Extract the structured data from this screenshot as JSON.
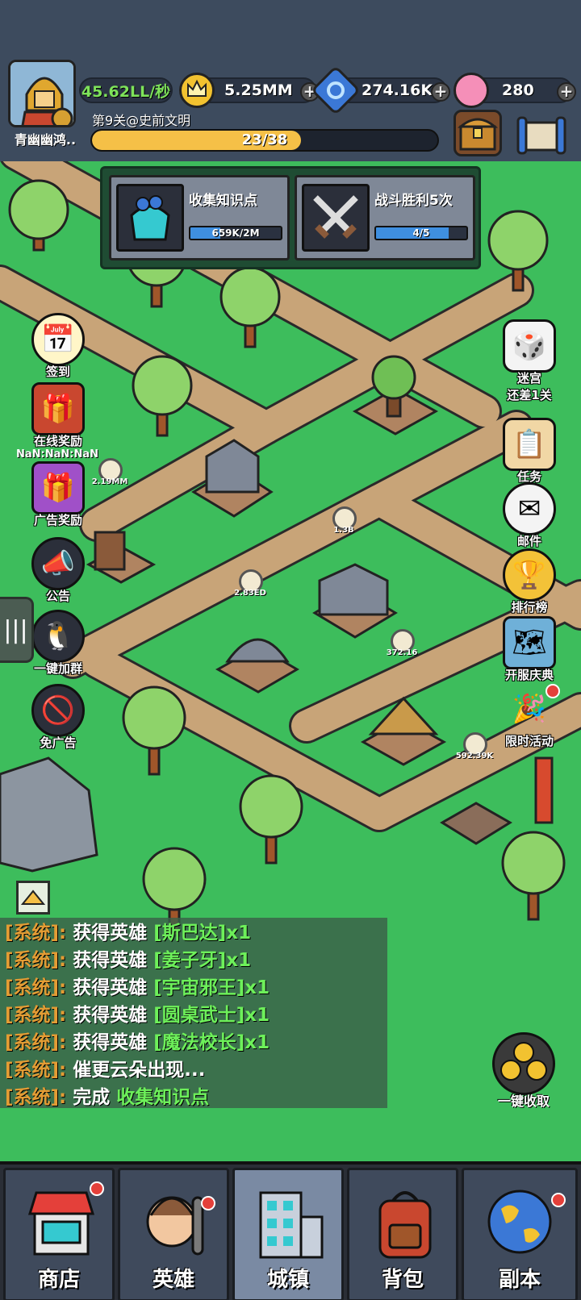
{
  "player": {
    "name": "青幽幽鸿..",
    "rate": "45.62LL/秒"
  },
  "resources": {
    "gold": "5.25MM",
    "gems": "274.16K",
    "candy": "280"
  },
  "level": {
    "label": "第9关@史前文明",
    "progress_text": "23/38",
    "progress": 0.605
  },
  "quests": [
    {
      "title": "收集知识点",
      "value": "659K/2M",
      "progress": 0.33
    },
    {
      "title": "战斗胜利5次",
      "value": "4/5",
      "progress": 0.8
    }
  ],
  "left_buttons": {
    "signin": "签到",
    "online_reward": "在线奖励",
    "timer": "NaN:NaN:NaN",
    "ad_reward": "广告奖励",
    "notice": "公告",
    "join_group": "一键加群",
    "no_ads": "免广告"
  },
  "right_buttons": {
    "maze": "迷宫",
    "maze_sub": "还差1关",
    "tasks": "任务",
    "mail": "邮件",
    "rank": "排行榜",
    "celebration": "开服庆典",
    "limited": "限时活动"
  },
  "chat": [
    {
      "prefix": "[系统]:",
      "text": "获得英雄",
      "hero": "[斯巴达]x1"
    },
    {
      "prefix": "[系统]:",
      "text": "获得英雄",
      "hero": "[姜子牙]x1"
    },
    {
      "prefix": "[系统]:",
      "text": "获得英雄",
      "hero": "[宇宙邪王]x1"
    },
    {
      "prefix": "[系统]:",
      "text": "获得英雄",
      "hero": "[圆桌武士]x1"
    },
    {
      "prefix": "[系统]:",
      "text": "获得英雄",
      "hero": "[魔法校长]x1"
    },
    {
      "prefix": "[系统]:",
      "text": "催更云朵出现...",
      "hero": ""
    },
    {
      "prefix": "[系统]:",
      "text": "完成",
      "hero": "收集知识点"
    }
  ],
  "collect_all": "一键收取",
  "building_labels": [
    "2.19MM",
    "1.3B",
    "2.83ED",
    "372.16",
    "592.39K"
  ],
  "nav": [
    {
      "label": "商店",
      "badge": true
    },
    {
      "label": "英雄",
      "badge": true
    },
    {
      "label": "城镇",
      "badge": false,
      "active": true
    },
    {
      "label": "背包",
      "badge": false
    },
    {
      "label": "副本",
      "badge": true
    }
  ],
  "colors": {
    "grass": "#3dbd5c",
    "path": "#c8a478",
    "gold_bar": "#f5c047",
    "system_text": "#e39c34",
    "hero_text": "#6df05a"
  }
}
